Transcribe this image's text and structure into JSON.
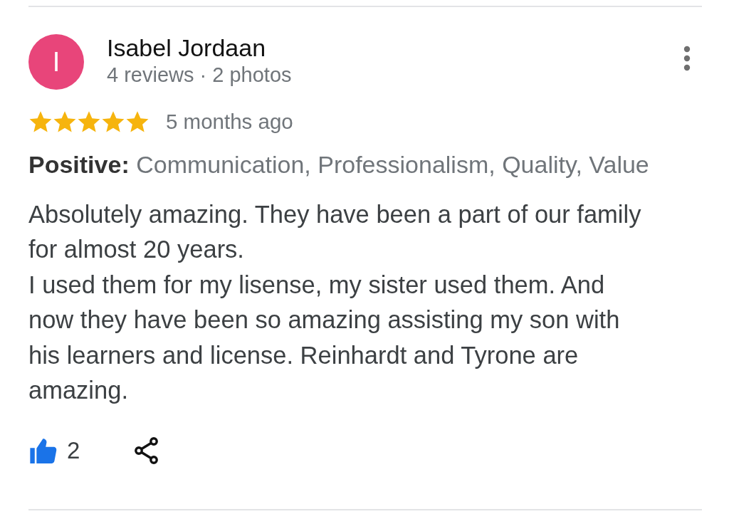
{
  "review": {
    "author": {
      "initial": "I",
      "name": "Isabel Jordaan",
      "meta": "4 reviews · 2 photos"
    },
    "stars": 5,
    "time": "5 months ago",
    "highlights": "**Positive:** Communication, Professionalism, Quality, Value",
    "paragraphs": [
      "Absolutely amazing. They have been a part of our family for almost 20 years.",
      "I used them for my lisense, my sister used them. And now they have been so amazing assisting my son with his learners and license. Reinhardt and Tyrone are amazing."
    ],
    "likes": {
      "count": "2",
      "liked": true
    }
  }
}
